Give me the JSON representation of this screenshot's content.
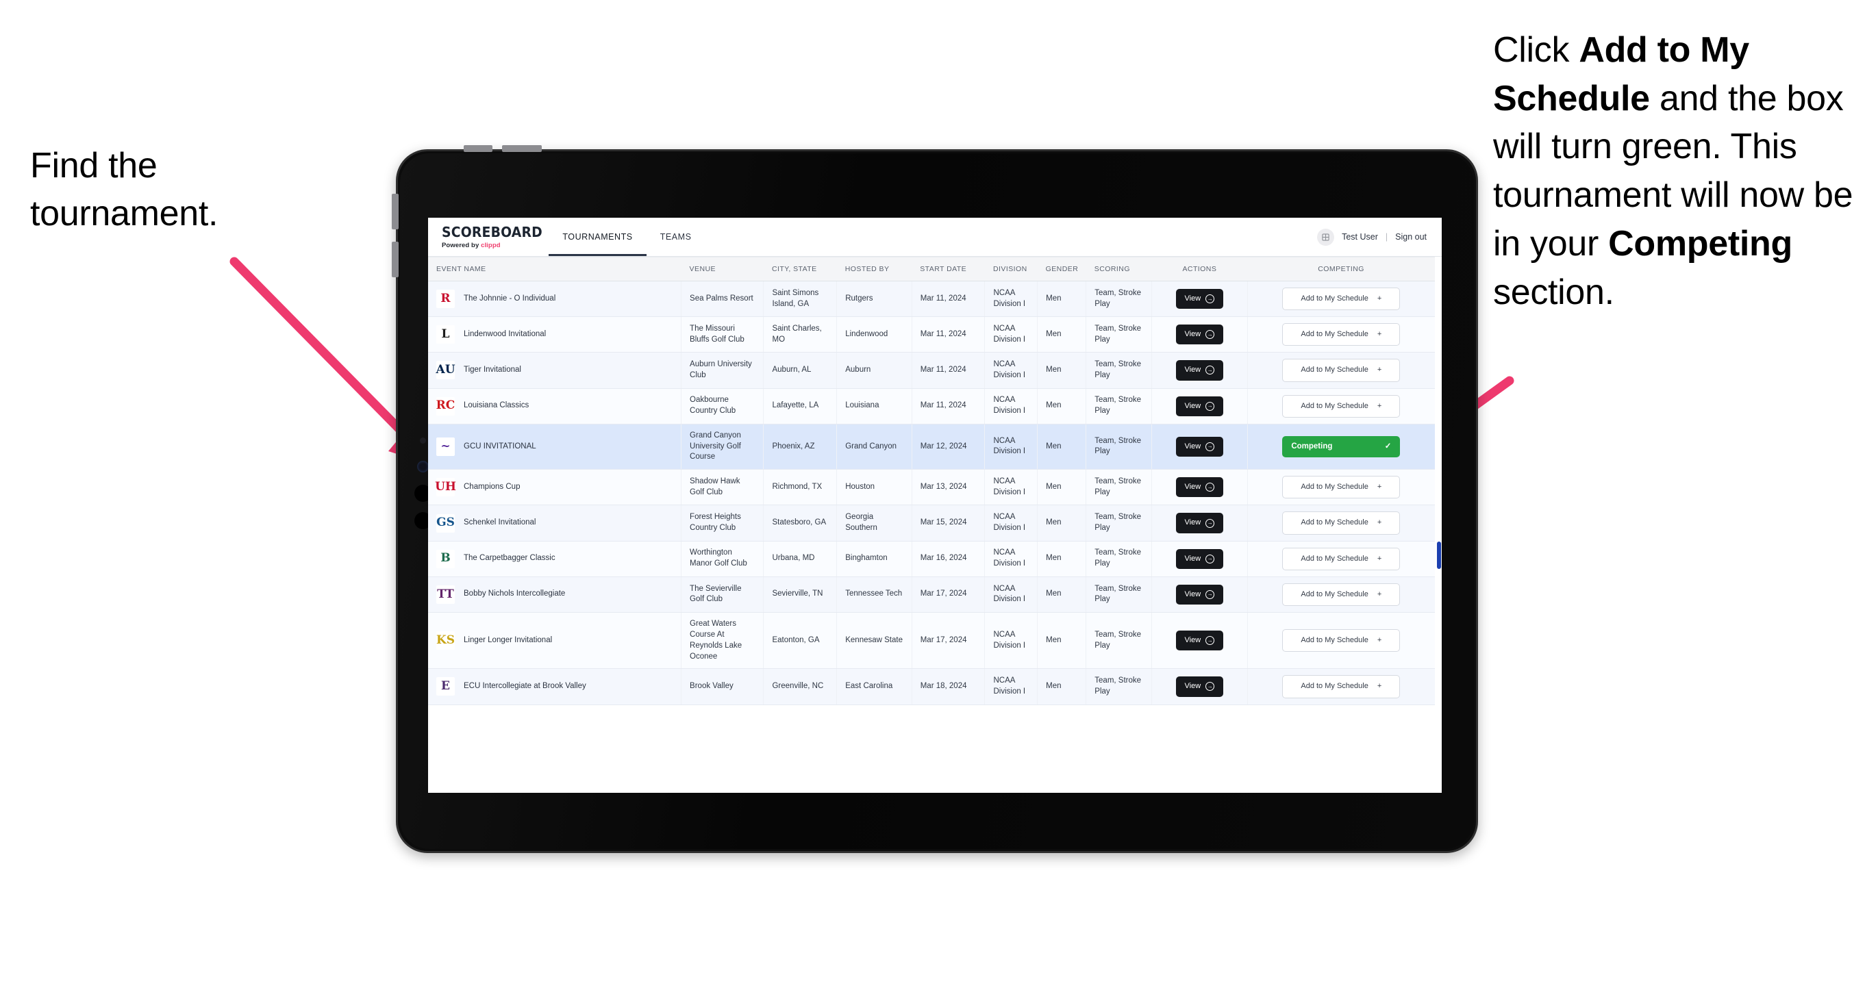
{
  "annotations": {
    "left": "Find the tournament.",
    "right_parts": [
      {
        "text": "Click ",
        "bold": false
      },
      {
        "text": "Add to My Schedule",
        "bold": true
      },
      {
        "text": " and the box will turn green. This tournament will now be in your ",
        "bold": false
      },
      {
        "text": "Competing",
        "bold": true
      },
      {
        "text": " section.",
        "bold": false
      }
    ],
    "arrow_color": "#ee3a6e"
  },
  "app": {
    "brand_title": "SCOREBOARD",
    "brand_sub_prefix": "Powered by ",
    "brand_sub_name": "clippd",
    "nav": [
      {
        "label": "TOURNAMENTS",
        "active": true
      },
      {
        "label": "TEAMS",
        "active": false
      }
    ],
    "user": {
      "avatar_icon": "user-grid-icon",
      "name": "Test User",
      "separator": "|",
      "sign_out": "Sign out"
    }
  },
  "table": {
    "columns": [
      "EVENT NAME",
      "VENUE",
      "CITY, STATE",
      "HOSTED BY",
      "START DATE",
      "DIVISION",
      "GENDER",
      "SCORING",
      "ACTIONS",
      "COMPETING"
    ],
    "view_label": "View",
    "add_label": "Add to My Schedule",
    "add_icon": "+",
    "competing_label": "Competing",
    "competing_icon": "check-icon",
    "competing_color": "#25a544",
    "rows": [
      {
        "logo_text": "R",
        "logo_bg": "#ffffff",
        "logo_color": "#c8102e",
        "event": "The Johnnie - O Individual",
        "venue": "Sea Palms Resort",
        "city": "Saint Simons Island, GA",
        "host": "Rutgers",
        "date": "Mar 11, 2024",
        "division": "NCAA Division I",
        "gender": "Men",
        "scoring": "Team, Stroke Play",
        "competing": false
      },
      {
        "logo_text": "L",
        "logo_bg": "#ffffff",
        "logo_color": "#1d1d1d",
        "event": "Lindenwood Invitational",
        "venue": "The Missouri Bluffs Golf Club",
        "city": "Saint Charles, MO",
        "host": "Lindenwood",
        "date": "Mar 11, 2024",
        "division": "NCAA Division I",
        "gender": "Men",
        "scoring": "Team, Stroke Play",
        "competing": false
      },
      {
        "logo_text": "AU",
        "logo_bg": "#ffffff",
        "logo_color": "#03244d",
        "event": "Tiger Invitational",
        "venue": "Auburn University Club",
        "city": "Auburn, AL",
        "host": "Auburn",
        "date": "Mar 11, 2024",
        "division": "NCAA Division I",
        "gender": "Men",
        "scoring": "Team, Stroke Play",
        "competing": false
      },
      {
        "logo_text": "RC",
        "logo_bg": "#ffffff",
        "logo_color": "#ce181e",
        "event": "Louisiana Classics",
        "venue": "Oakbourne Country Club",
        "city": "Lafayette, LA",
        "host": "Louisiana",
        "date": "Mar 11, 2024",
        "division": "NCAA Division I",
        "gender": "Men",
        "scoring": "Team, Stroke Play",
        "competing": false
      },
      {
        "logo_text": "~",
        "logo_bg": "#ffffff",
        "logo_color": "#522398",
        "event": "GCU INVITATIONAL",
        "venue": "Grand Canyon University Golf Course",
        "city": "Phoenix, AZ",
        "host": "Grand Canyon",
        "date": "Mar 12, 2024",
        "division": "NCAA Division I",
        "gender": "Men",
        "scoring": "Team, Stroke Play",
        "competing": true
      },
      {
        "logo_text": "UH",
        "logo_bg": "#ffffff",
        "logo_color": "#c8102e",
        "event": "Champions Cup",
        "venue": "Shadow Hawk Golf Club",
        "city": "Richmond, TX",
        "host": "Houston",
        "date": "Mar 13, 2024",
        "division": "NCAA Division I",
        "gender": "Men",
        "scoring": "Team, Stroke Play",
        "competing": false
      },
      {
        "logo_text": "GS",
        "logo_bg": "#ffffff",
        "logo_color": "#14548c",
        "event": "Schenkel Invitational",
        "venue": "Forest Heights Country Club",
        "city": "Statesboro, GA",
        "host": "Georgia Southern",
        "date": "Mar 15, 2024",
        "division": "NCAA Division I",
        "gender": "Men",
        "scoring": "Team, Stroke Play",
        "competing": false
      },
      {
        "logo_text": "B",
        "logo_bg": "#ffffff",
        "logo_color": "#1c6b4c",
        "event": "The Carpetbagger Classic",
        "venue": "Worthington Manor Golf Club",
        "city": "Urbana, MD",
        "host": "Binghamton",
        "date": "Mar 16, 2024",
        "division": "NCAA Division I",
        "gender": "Men",
        "scoring": "Team, Stroke Play",
        "competing": false
      },
      {
        "logo_text": "TT",
        "logo_bg": "#ffffff",
        "logo_color": "#62256b",
        "event": "Bobby Nichols Intercollegiate",
        "venue": "The Sevierville Golf Club",
        "city": "Sevierville, TN",
        "host": "Tennessee Tech",
        "date": "Mar 17, 2024",
        "division": "NCAA Division I",
        "gender": "Men",
        "scoring": "Team, Stroke Play",
        "competing": false
      },
      {
        "logo_text": "KS",
        "logo_bg": "#ffffff",
        "logo_color": "#c8a415",
        "event": "Linger Longer Invitational",
        "venue": "Great Waters Course At Reynolds Lake Oconee",
        "city": "Eatonton, GA",
        "host": "Kennesaw State",
        "date": "Mar 17, 2024",
        "division": "NCAA Division I",
        "gender": "Men",
        "scoring": "Team, Stroke Play",
        "competing": false
      },
      {
        "logo_text": "E",
        "logo_bg": "#ffffff",
        "logo_color": "#4b2a6e",
        "event": "ECU Intercollegiate at Brook Valley",
        "venue": "Brook Valley",
        "city": "Greenville, NC",
        "host": "East Carolina",
        "date": "Mar 18, 2024",
        "division": "NCAA Division I",
        "gender": "Men",
        "scoring": "Team, Stroke Play",
        "competing": false
      }
    ]
  }
}
